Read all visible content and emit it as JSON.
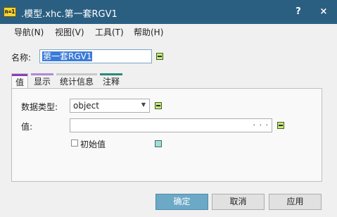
{
  "window": {
    "title": ".模型.xhc.第一套RGV1",
    "app_icon_text": "n=1",
    "help_glyph": "?",
    "close_glyph": "×"
  },
  "menu": [
    {
      "label": "导航(N)"
    },
    {
      "label": "视图(V)"
    },
    {
      "label": "工具(T)"
    },
    {
      "label": "帮助(H)"
    }
  ],
  "name_field": {
    "label": "名称:",
    "value": "第一套RGV1"
  },
  "tabs": [
    {
      "label": "值",
      "color": "#8a3fb8",
      "active": true
    },
    {
      "label": "显示",
      "color": "#b08ad8",
      "active": false
    },
    {
      "label": "统计信息",
      "color": "#c8c8c8",
      "active": false
    },
    {
      "label": "注释",
      "color": "#2a8a7a",
      "active": false
    }
  ],
  "value_tab": {
    "data_type_label": "数据类型:",
    "data_type_value": "object",
    "value_label": "值:",
    "value_field_value": "",
    "value_ellipsis": "· · ·",
    "initial_value_label": "初始值",
    "initial_value_checked": false
  },
  "buttons": {
    "ok": "确定",
    "cancel": "取消",
    "apply": "应用"
  },
  "colors": {
    "titlebar": "#2b5f82",
    "primary_button": "#6ca9c6",
    "ellipsis_button": "#c8ea7a",
    "selection": "#3b7bd8"
  }
}
